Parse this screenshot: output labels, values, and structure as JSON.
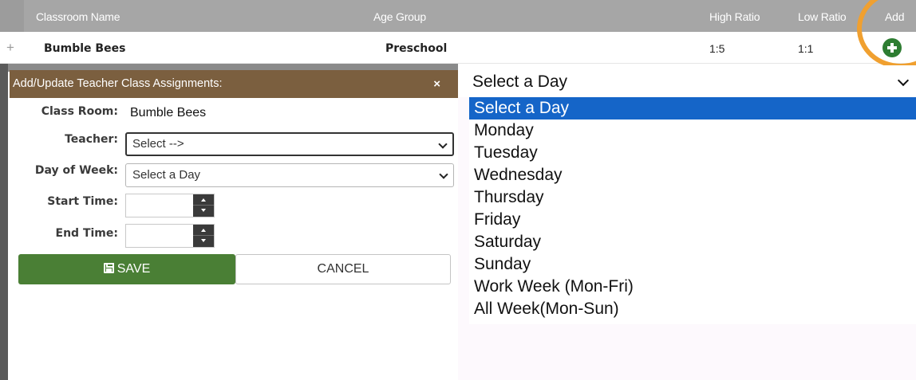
{
  "grid": {
    "columns": {
      "classroom_name": "Classroom Name",
      "age_group": "Age Group",
      "high_ratio": "High Ratio",
      "low_ratio": "Low Ratio",
      "add": "Add"
    },
    "row": {
      "expand_symbol": "+",
      "classroom_name": "Bumble Bees",
      "age_group": "Preschool",
      "high_ratio": "1:5",
      "low_ratio": "1:1",
      "add_icon": "plus-circle-icon"
    },
    "colors": {
      "header_bg": "#a6a6a6",
      "add_green": "#2e7d32",
      "highlight_ring": "#f0a030"
    }
  },
  "modal": {
    "title": "Add/Update Teacher Class Assignments:",
    "close_symbol": "×",
    "fields": {
      "classroom_label": "Class Room:",
      "classroom_value": "Bumble Bees",
      "teacher_label": "Teacher:",
      "teacher_value": "Select -->",
      "day_label": "Day of Week:",
      "day_value": "Select a Day",
      "start_label": "Start Time:",
      "start_value": "",
      "end_label": "End Time:",
      "end_value": ""
    },
    "buttons": {
      "save": "SAVE",
      "save_icon": "floppy-disk-icon",
      "cancel": "CANCEL"
    },
    "colors": {
      "title_bg": "#7b5f3f",
      "save_bg": "#4a7f35"
    }
  },
  "day_dropdown": {
    "selected_value": "Select a Day",
    "options": [
      "Select a Day",
      "Monday",
      "Tuesday",
      "Wednesday",
      "Thursday",
      "Friday",
      "Saturday",
      "Sunday",
      "Work Week (Mon-Fri)",
      "All Week(Mon-Sun)"
    ],
    "highlighted_index": 0,
    "colors": {
      "highlight_bg": "#1565c8"
    }
  }
}
